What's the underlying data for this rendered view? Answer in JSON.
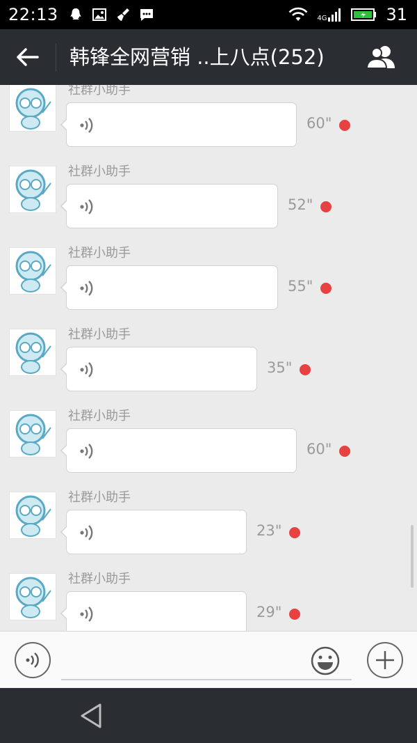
{
  "status_bar": {
    "time": "22:13",
    "network_label": "4G",
    "battery_level": "31",
    "icons": [
      "qq-penguin-icon",
      "image-icon",
      "broom-icon",
      "chat-icon",
      "wifi-icon",
      "signal-icon",
      "battery-icon"
    ]
  },
  "header": {
    "title": "韩锋全网营销 ..上八点(252)",
    "icons": [
      "back-arrow-icon",
      "group-members-icon"
    ]
  },
  "messages": [
    {
      "sender": "社群小助手",
      "duration": "60\"",
      "unread": true
    },
    {
      "sender": "社群小助手",
      "duration": "52\"",
      "unread": true
    },
    {
      "sender": "社群小助手",
      "duration": "55\"",
      "unread": true
    },
    {
      "sender": "社群小助手",
      "duration": "35\"",
      "unread": true
    },
    {
      "sender": "社群小助手",
      "duration": "60\"",
      "unread": true
    },
    {
      "sender": "社群小助手",
      "duration": "23\"",
      "unread": true
    },
    {
      "sender": "社群小助手",
      "duration": "29\"",
      "unread": true
    }
  ],
  "input_bar": {
    "message_value": "",
    "icons": [
      "voice-mode-icon",
      "emoji-icon",
      "plus-icon"
    ]
  },
  "nav_bar": {
    "icons": [
      "nav-back-icon"
    ]
  },
  "colors": {
    "header_bg": "#2a2d32",
    "chat_bg": "#ebebeb",
    "unread_dot": "#e84141",
    "avatar_blue": "#5aa9c4"
  }
}
